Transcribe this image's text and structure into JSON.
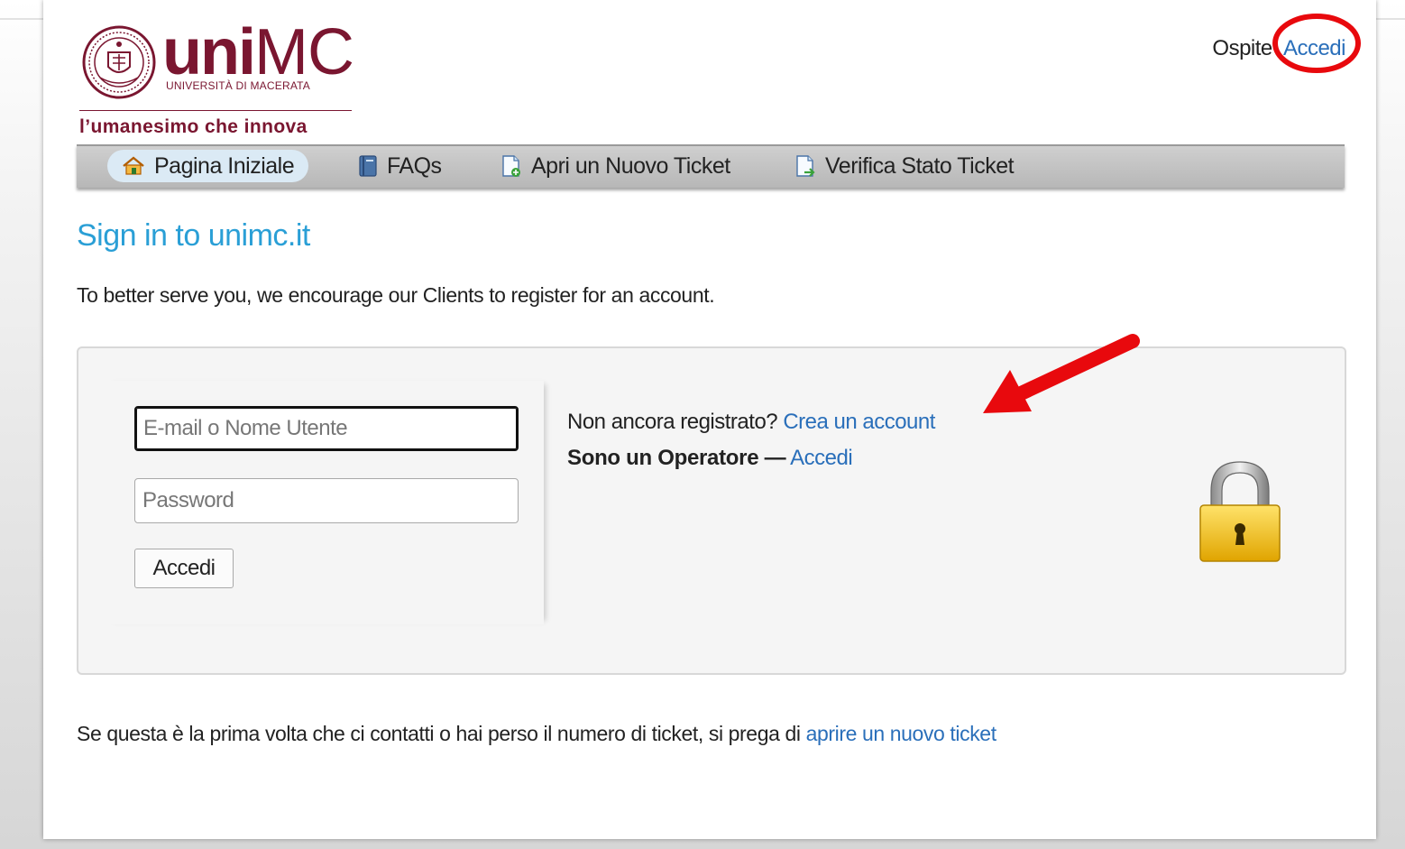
{
  "header": {
    "logo_word_bold": "uni",
    "logo_word_light": "MC",
    "logo_subtitle": "UNIVERSITÀ DI MACERATA",
    "logo_tagline": "l’umanesimo che innova",
    "guest_label": "Ospite",
    "login_link": "Accedi"
  },
  "nav": {
    "items": [
      {
        "label": "Pagina Iniziale",
        "icon": "home-icon",
        "active": true
      },
      {
        "label": "FAQs",
        "icon": "book-icon",
        "active": false
      },
      {
        "label": "Apri un Nuovo Ticket",
        "icon": "new-ticket-icon",
        "active": false
      },
      {
        "label": "Verifica Stato Ticket",
        "icon": "ticket-status-icon",
        "active": false
      }
    ]
  },
  "main": {
    "title": "Sign in to unimc.it",
    "intro": "To better serve you, we encourage our Clients to register for an account.",
    "form": {
      "email_placeholder": "E-mail o Nome Utente",
      "password_placeholder": "Password",
      "submit_label": "Accedi"
    },
    "info": {
      "not_registered": "Non ancora registrato?",
      "create_account": "Crea un account",
      "operator_label": "Sono un Operatore —",
      "operator_login": "Accedi"
    },
    "bottom_text": "Se questa è la prima volta che ci contatti o hai perso il numero di ticket, si prega di",
    "bottom_link": "aprire un nuovo ticket"
  },
  "colors": {
    "brand": "#7a1630",
    "title_blue": "#2a9fd6",
    "link_blue": "#2a6fba",
    "annotation_red": "#e8090d"
  }
}
